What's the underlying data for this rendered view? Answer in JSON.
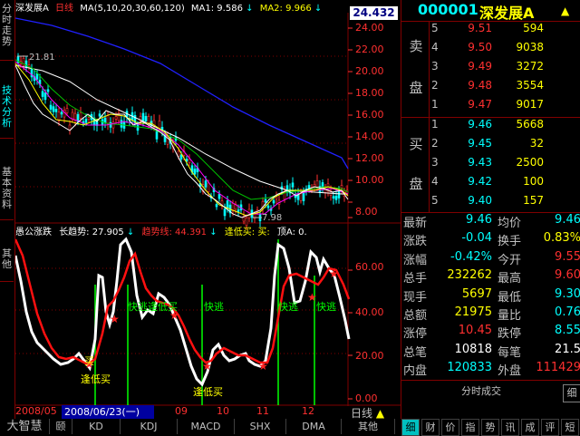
{
  "left_tabs": [
    "分时走势",
    "技术分析",
    "基本资料",
    "其他"
  ],
  "chart_header": {
    "name": "深发展A",
    "period": "日线",
    "ma_params": "MA(5,10,20,30,60,120)",
    "ma1": "MA1: 9.586",
    "ma1_arrow": "↓",
    "ma2": "MA2: 9.966",
    "ma2_arrow": "↓"
  },
  "current_price_box": "24.432",
  "price_axis": [
    "24.00",
    "22.00",
    "20.00",
    "18.00",
    "16.00",
    "14.00",
    "12.00",
    "10.00",
    "8.00"
  ],
  "annotations": {
    "high_mark": "21.81",
    "low_mark": "7.98"
  },
  "indicator_header": {
    "name": "愚公涨跌",
    "long_trend": "长趋势: 27.905",
    "long_arrow": "↓",
    "trend_line": "趋势线: 44.391",
    "trend_arrow": "↓",
    "low_buy": "逢低买: 买:",
    "top": "顶A: 0."
  },
  "indicator_axis": [
    "60.00",
    "40.00",
    "20.00",
    "0.00"
  ],
  "indicator_labels": {
    "buy": "买",
    "low_buy": "逢低买",
    "quick_escape": "快逃",
    "quick_escape_low_buy": "快逃逢低买"
  },
  "stock": {
    "code": "000001",
    "name": "深发展A",
    "arrow_glyph": "▲"
  },
  "sell_label": "卖盘",
  "buy_label": "买盘",
  "sell_orders": [
    {
      "level": "5",
      "price": "9.51",
      "qty": "594"
    },
    {
      "level": "4",
      "price": "9.50",
      "qty": "9038"
    },
    {
      "level": "3",
      "price": "9.49",
      "qty": "3272"
    },
    {
      "level": "2",
      "price": "9.48",
      "qty": "3554"
    },
    {
      "level": "1",
      "price": "9.47",
      "qty": "9017"
    }
  ],
  "buy_orders": [
    {
      "level": "1",
      "price": "9.46",
      "qty": "5668"
    },
    {
      "level": "2",
      "price": "9.45",
      "qty": "32"
    },
    {
      "level": "3",
      "price": "9.43",
      "qty": "2500"
    },
    {
      "level": "4",
      "price": "9.42",
      "qty": "100"
    },
    {
      "level": "5",
      "price": "9.40",
      "qty": "157"
    }
  ],
  "quotes": [
    {
      "k1": "最新",
      "v1": "9.46",
      "c1": "cyn",
      "k2": "均价",
      "v2": "9.46",
      "c2": "cyn"
    },
    {
      "k1": "涨跌",
      "v1": "-0.04",
      "c1": "cyn",
      "k2": "换手",
      "v2": "0.83%",
      "c2": "yel"
    },
    {
      "k1": "涨幅",
      "v1": "-0.42%",
      "c1": "cyn",
      "k2": "今开",
      "v2": "9.55",
      "c2": "red"
    },
    {
      "k1": "总手",
      "v1": "232262",
      "c1": "yel",
      "k2": "最高",
      "v2": "9.60",
      "c2": "red"
    },
    {
      "k1": "现手",
      "v1": "5697",
      "c1": "yel",
      "k2": "最低",
      "v2": "9.30",
      "c2": "cyn"
    },
    {
      "k1": "总额",
      "v1": "21975",
      "c1": "yel",
      "k2": "量比",
      "v2": "0.76",
      "c2": "cyn"
    },
    {
      "k1": "涨停",
      "v1": "10.45",
      "c1": "red",
      "k2": "跌停",
      "v2": "8.55",
      "c2": "cyn"
    },
    {
      "k1": "总笔",
      "v1": "10818",
      "c1": "wht",
      "k2": "每笔",
      "v2": "21.5",
      "c2": "wht"
    },
    {
      "k1": "内盘",
      "v1": "120833",
      "c1": "cyn",
      "k2": "外盘",
      "v2": "111429",
      "c2": "red"
    }
  ],
  "rp_bottom_label": "分时成交",
  "rp_fen": "细",
  "rp_tabs": [
    "细",
    "财",
    "价",
    "指",
    "势",
    "讯",
    "成",
    "评",
    "短"
  ],
  "date_axis": {
    "start": "2008/05",
    "cursor_date": "2008/06/23(一)",
    "m9": "09",
    "m10": "10",
    "m11": "11",
    "m12": "12"
  },
  "period_label": "日线",
  "period_arrow": "▲",
  "bottom_tabs": [
    "大智慧",
    "颐",
    "KD",
    "KDJ",
    "MACD",
    "SHX",
    "DMA",
    "其他"
  ],
  "colors": {
    "up": "#ff3030",
    "down": "#00ffff",
    "grid": "#800000",
    "ma_long": "#2020ff"
  }
}
